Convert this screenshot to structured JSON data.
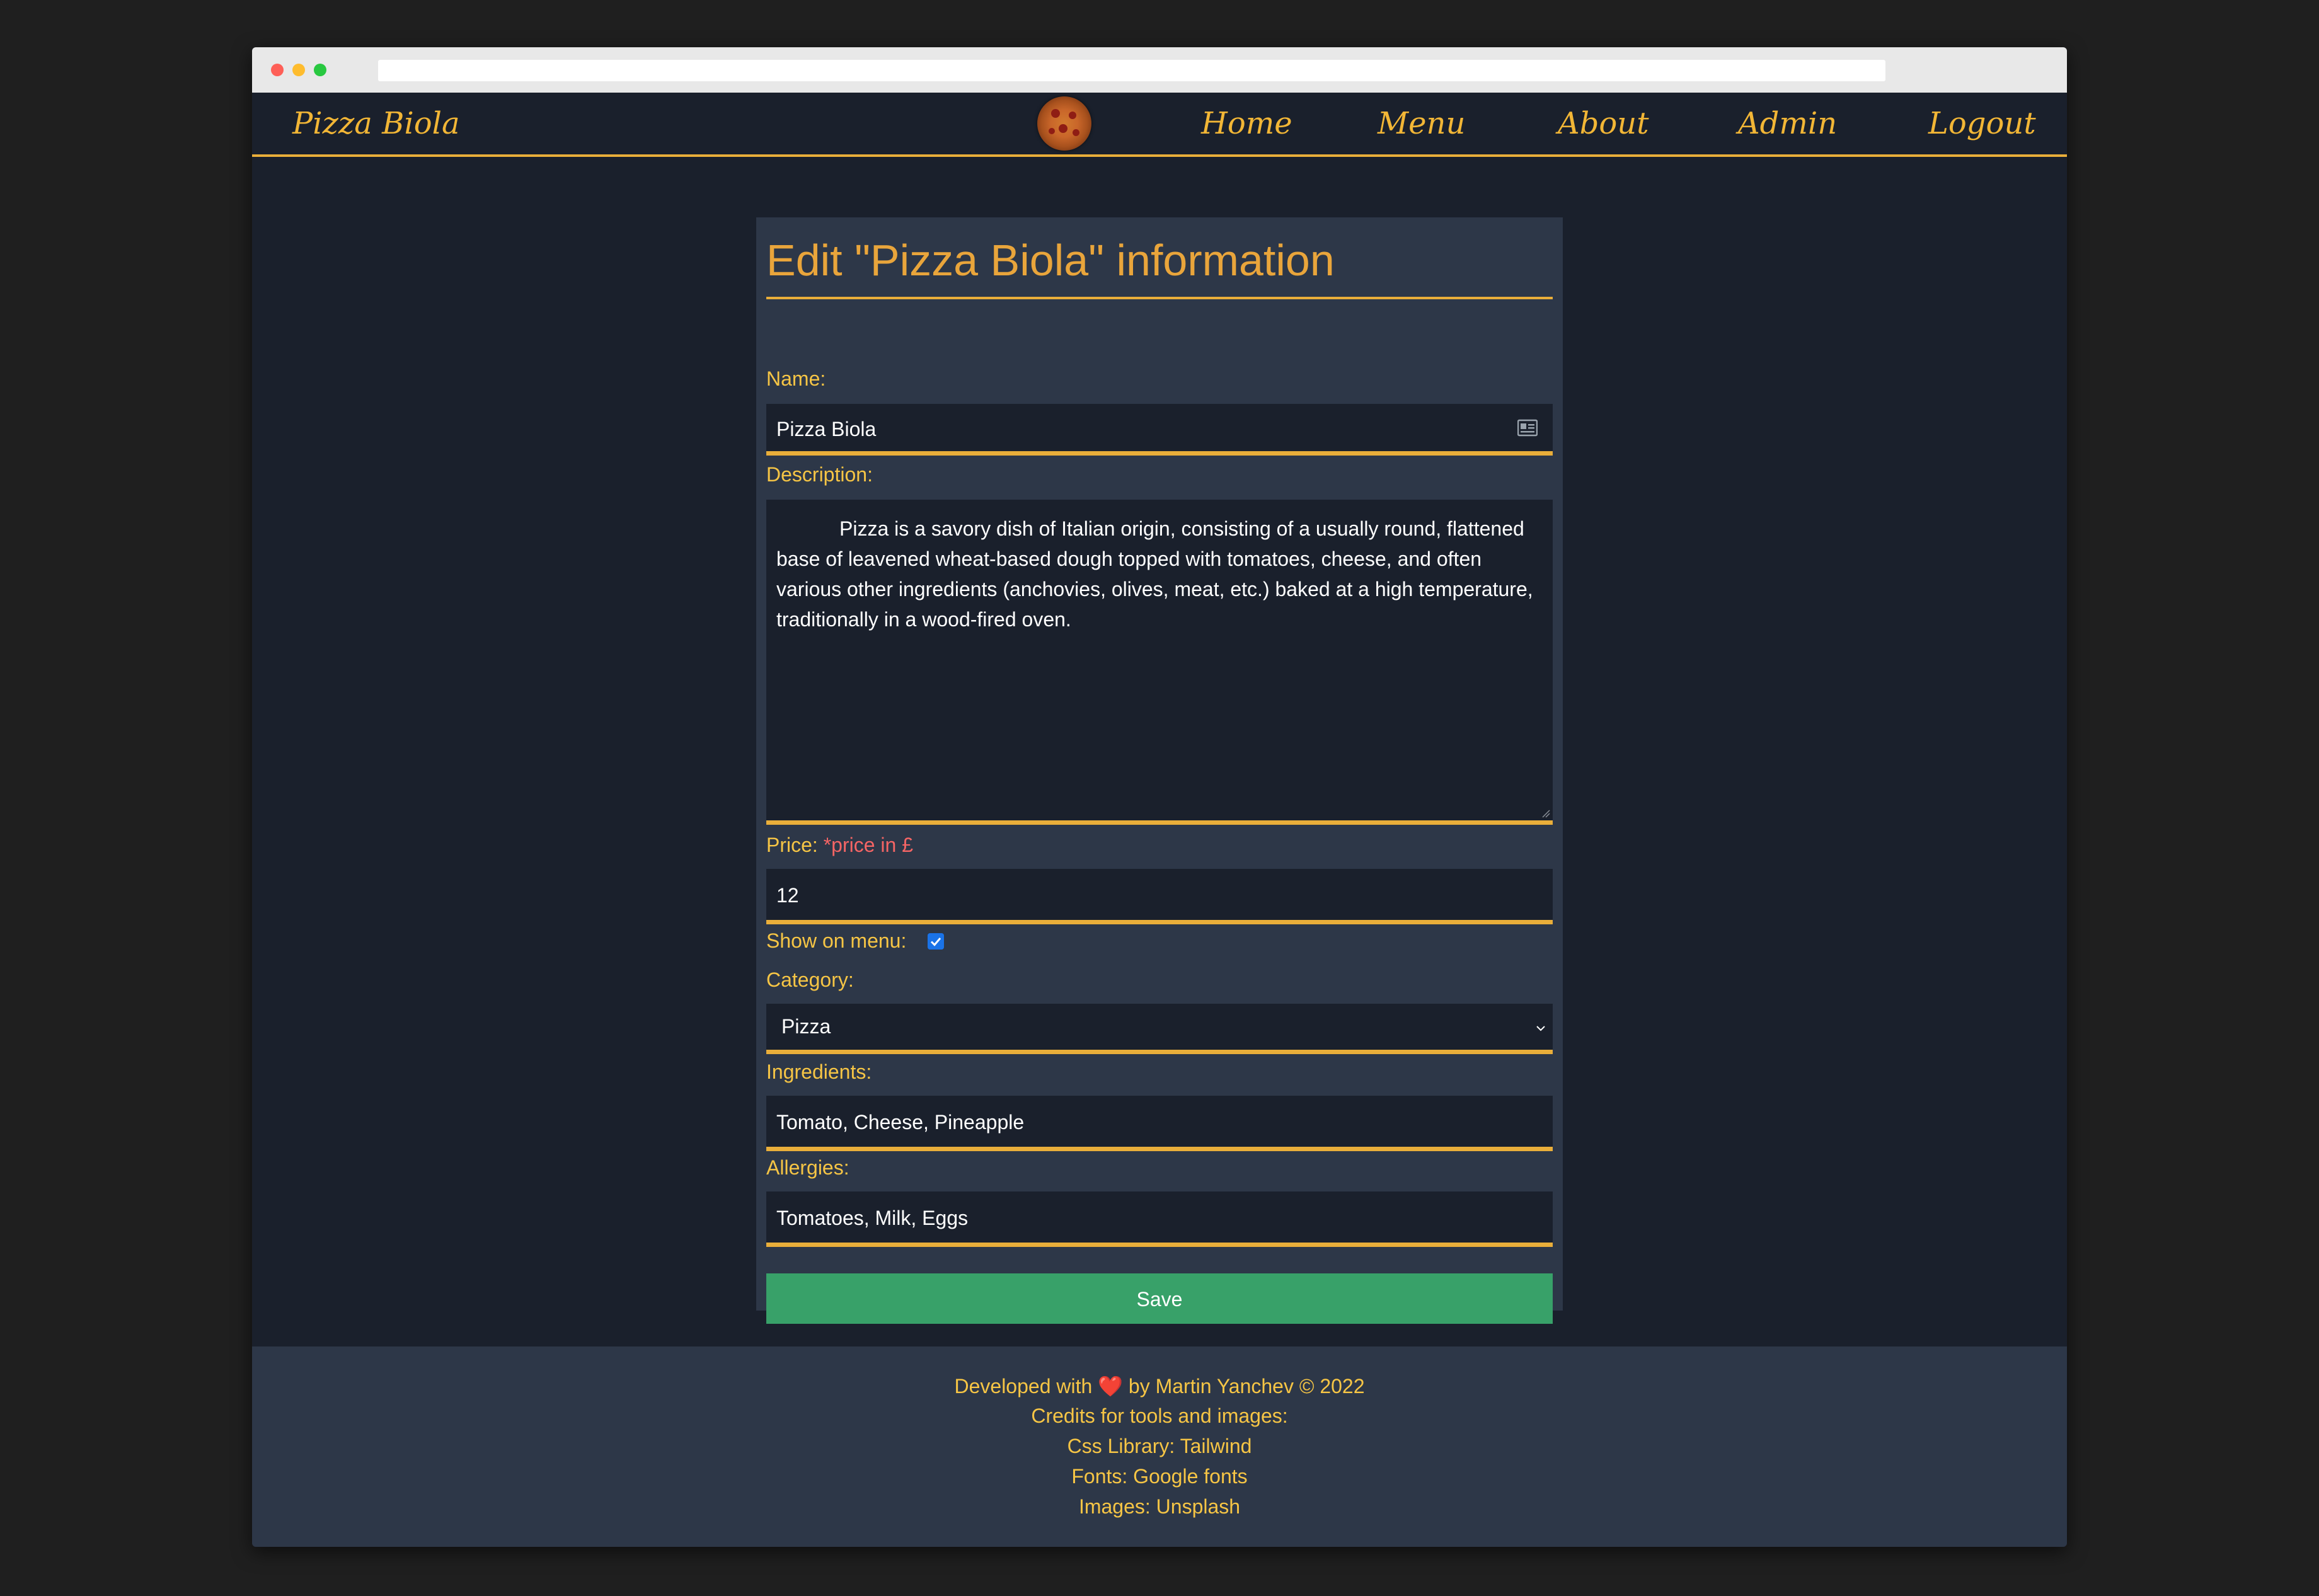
{
  "navbar": {
    "brand": "Pizza Biola",
    "links": [
      "Home",
      "Menu",
      "About",
      "Admin",
      "Logout"
    ]
  },
  "form": {
    "title": "Edit \"Pizza Biola\" information",
    "name_label": "Name:",
    "name_value": "Pizza Biola",
    "description_label": "Description:",
    "description_value": "Pizza is a savory dish of Italian origin, consisting of a usually round, flattened base of leavened wheat-based dough topped with tomatoes, cheese, and often various other ingredients (anchovies, olives, meat, etc.) baked at a high temperature, traditionally in a wood-fired oven.",
    "price_label": "Price:",
    "price_note": "*price in £",
    "price_value": "12",
    "show_on_menu_label": "Show on menu:",
    "show_on_menu_checked": true,
    "category_label": "Category:",
    "category_value": "Pizza",
    "ingredients_label": "Ingredients:",
    "ingredients_value": "Tomato, Cheese, Pineapple",
    "allergies_label": "Allergies:",
    "allergies_value": "Tomatoes, Milk, Eggs",
    "save_label": "Save"
  },
  "footer": {
    "developed_prefix": "Developed with",
    "heart": "❤️",
    "developed_suffix": "by Martin Yanchev © 2022",
    "credits": "Credits for tools and images:",
    "css_library": "Css Library: Tailwind",
    "fonts": "Fonts: Google fonts",
    "images": "Images: Unsplash"
  },
  "colors": {
    "accent": "#e9ae3a",
    "label": "#f6c545",
    "card_bg": "#2d3748",
    "page_bg": "#1a202c",
    "save_button": "#38a169",
    "price_note": "#f56565"
  }
}
